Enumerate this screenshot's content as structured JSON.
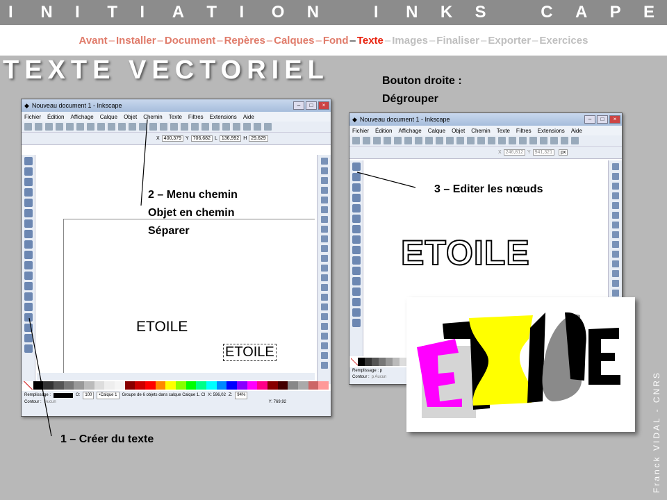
{
  "header": {
    "title_letters": [
      "I",
      "N",
      "I",
      "T",
      "I",
      "A",
      "T",
      "I",
      "O",
      "N",
      "",
      "I",
      "N",
      "K",
      "S",
      "",
      "C",
      "A",
      "P",
      "E"
    ]
  },
  "nav": {
    "items": [
      {
        "label": "Avant",
        "color": "#e07b6a"
      },
      {
        "label": "Installer",
        "color": "#e07b6a"
      },
      {
        "label": "Document",
        "color": "#e07b6a"
      },
      {
        "label": "Repères",
        "color": "#e07b6a"
      },
      {
        "label": "Calques",
        "color": "#e07b6a"
      },
      {
        "label": "Fond",
        "color": "#e07b6a"
      },
      {
        "label": "Texte",
        "color": "#e8200c"
      },
      {
        "label": "Images",
        "color": "#bfbfbf"
      },
      {
        "label": "Finaliser",
        "color": "#bfbfbf"
      },
      {
        "label": "Exporter",
        "color": "#bfbfbf"
      },
      {
        "label": "Exercices",
        "color": "#bfbfbf"
      }
    ],
    "separator": "–"
  },
  "page_title": "TEXTE VECTORIEL",
  "notes": {
    "right_click_1": "Bouton droite :",
    "right_click_2": "Dégrouper",
    "step2_1": "2 – Menu chemin",
    "step2_2": "Objet en chemin",
    "step2_3": "Séparer",
    "step3": "3 – Editer les nœuds",
    "step1": "1 – Créer du texte"
  },
  "window1": {
    "title": "Nouveau document 1 - Inkscape",
    "menu": [
      "Fichier",
      "Édition",
      "Affichage",
      "Calque",
      "Objet",
      "Chemin",
      "Texte",
      "Filtres",
      "Extensions",
      "Aide"
    ],
    "x_label": "X",
    "x_value": "400,379",
    "y_label": "Y",
    "y_value": "706,682",
    "w_label": "L",
    "w_value": "136,992",
    "h_label": "H",
    "h_value": "29,629",
    "canvas_text": "ETOILE",
    "canvas_text_selected": "ETOILE",
    "fill_label": "Remplissage :",
    "stroke_label": "Contour :",
    "stroke_value": "Aucun",
    "opacity_label": "O:",
    "opacity_value": "100",
    "layer_value": "•Calque 1",
    "status_text": "Groupe de 6 objets dans calque Calque 1. Cl",
    "coord_x": "X: 596,02",
    "coord_y": "Y: 769,92",
    "zoom_label": "Z:",
    "zoom_value": "94%"
  },
  "window2": {
    "title": "Nouveau document 1 - Inkscape",
    "menu": [
      "Fichier",
      "Édition",
      "Affichage",
      "Calque",
      "Objet",
      "Chemin",
      "Texte",
      "Filtres",
      "Extensions",
      "Aide"
    ],
    "x_label": "X",
    "x_value": "246,812",
    "y_label": "Y",
    "y_value": "941,321",
    "unit": "px",
    "canvas_text": "ETOILE",
    "fill_label": "Remplissage : p",
    "stroke_label": "Contour :",
    "stroke_value": "p Aucun"
  },
  "result_image": {
    "letters": [
      "E",
      "T",
      "O",
      "I",
      "L",
      "E"
    ]
  },
  "credit": "Franck VIDAL - CNRS",
  "colors": {
    "band": "#8c8c8c",
    "background": "#b8b8b8",
    "magenta": "#ff00ff",
    "yellow": "#ffff00",
    "black": "#000000",
    "grey": "#8a8a8a"
  }
}
